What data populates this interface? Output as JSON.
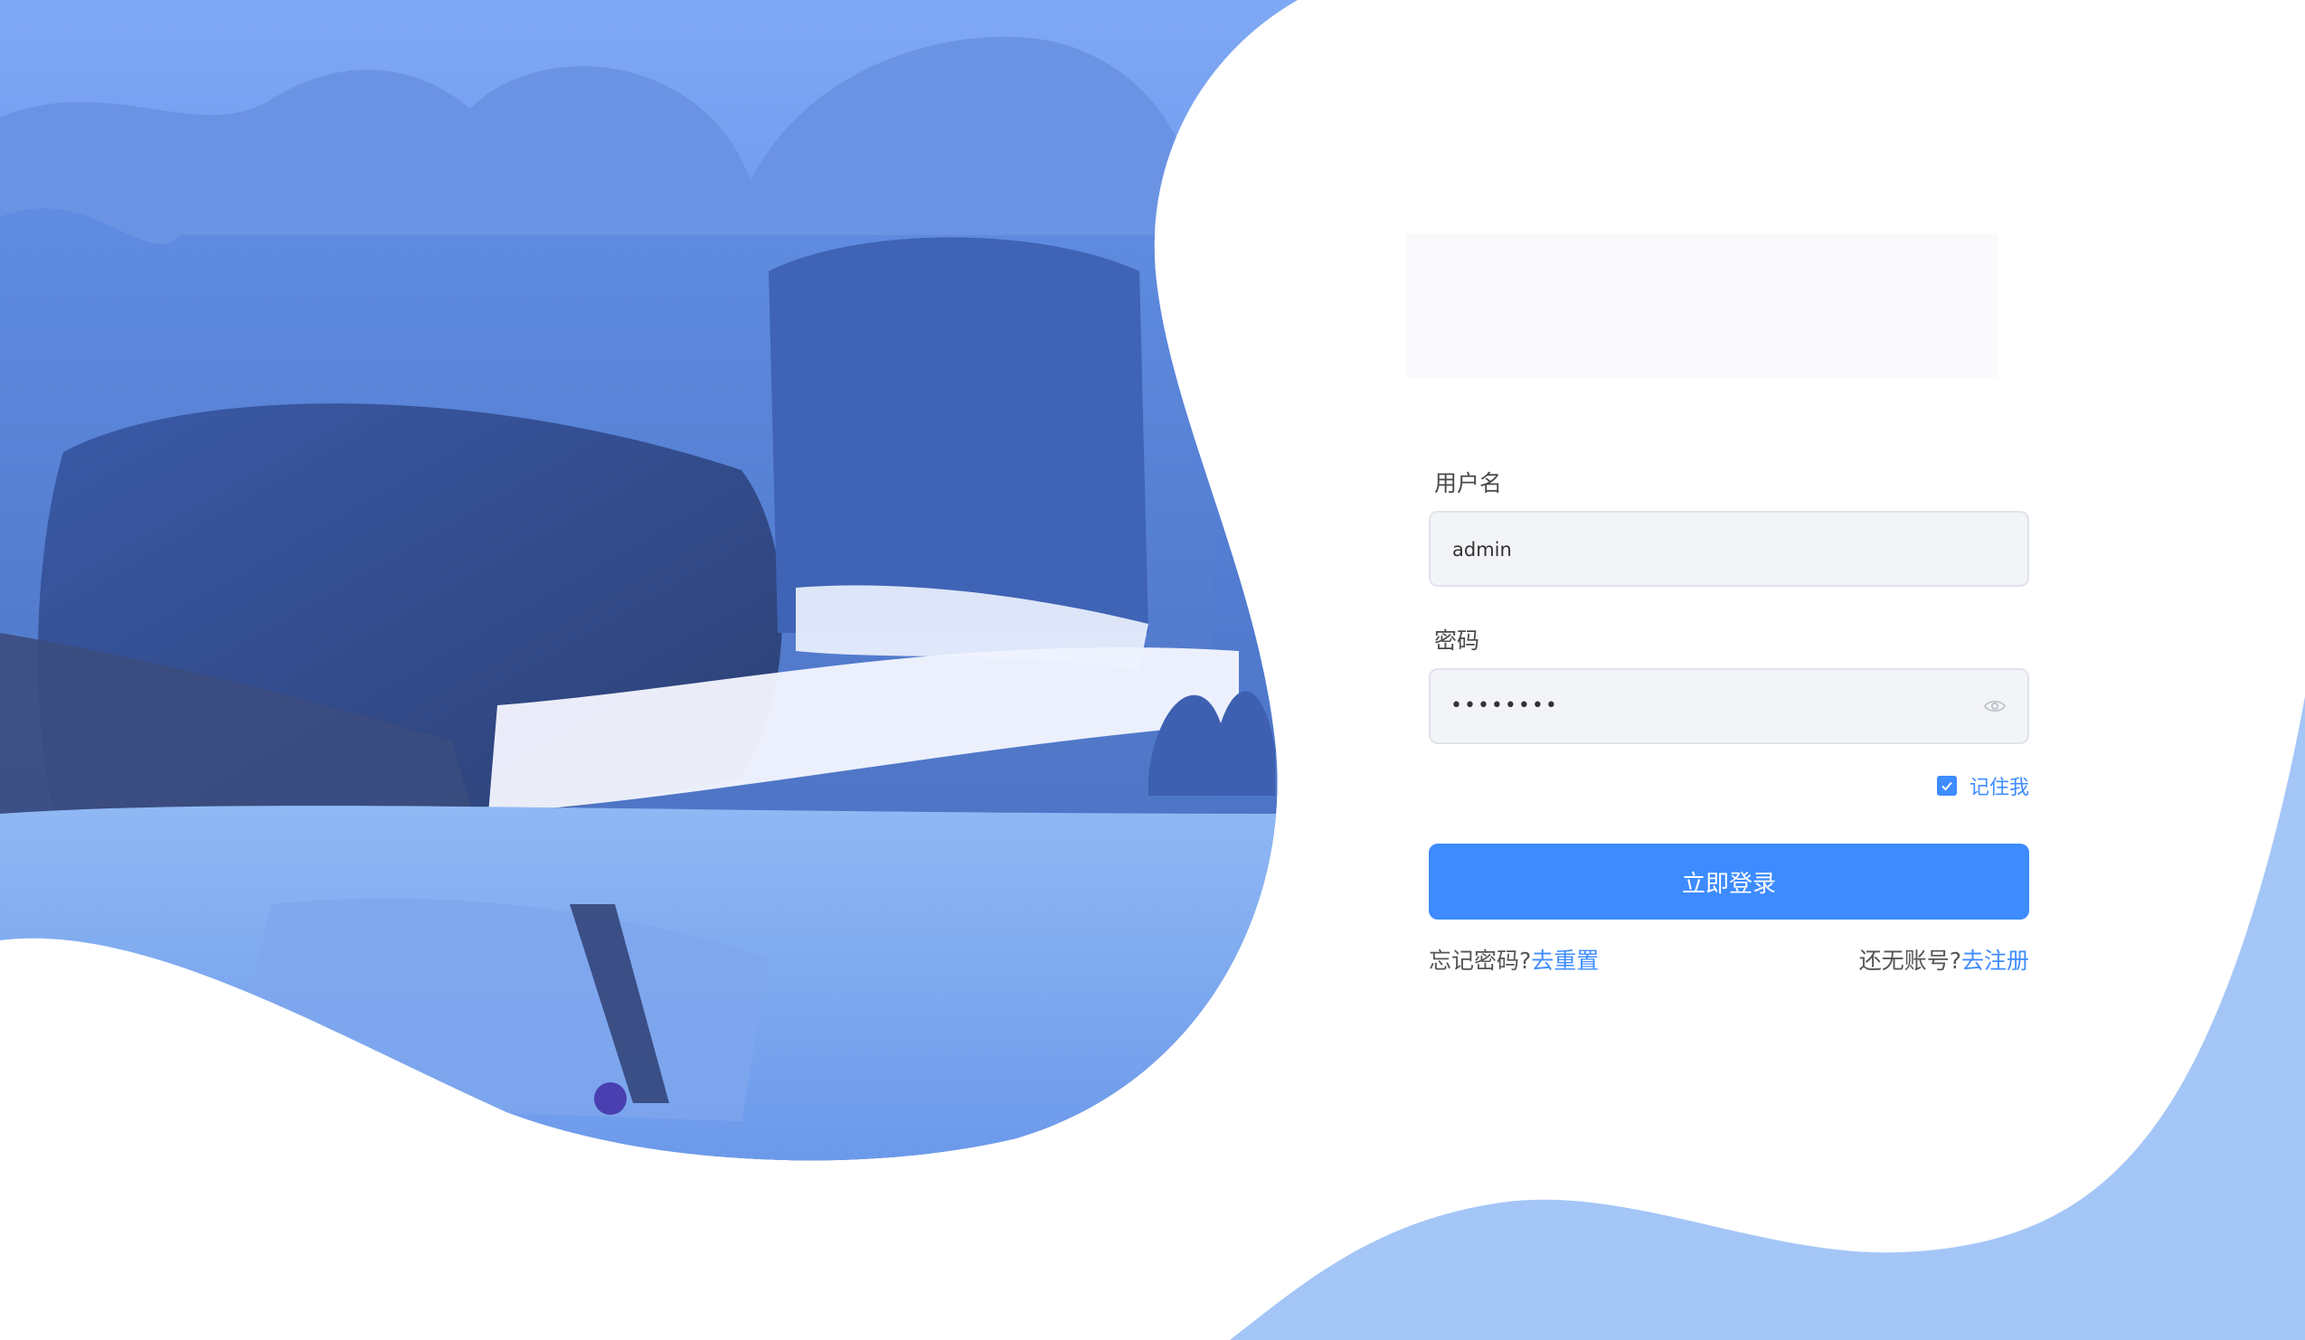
{
  "form": {
    "username_label": "用户名",
    "username_value": "admin",
    "password_label": "密码",
    "password_value": "••••••••",
    "remember_label": "记住我",
    "remember_checked": true,
    "login_button": "立即登录",
    "forgot_prefix": "忘记密码?",
    "forgot_link": "去重置",
    "register_prefix": "还无账号?",
    "register_link": "去注册"
  },
  "icons": {
    "eye": "eye-icon",
    "checkbox": "checkmark-icon"
  },
  "colors": {
    "primary": "#3d8bff",
    "background_wave": "#a9c8f8",
    "illustration_primary": "#4d7de0"
  }
}
